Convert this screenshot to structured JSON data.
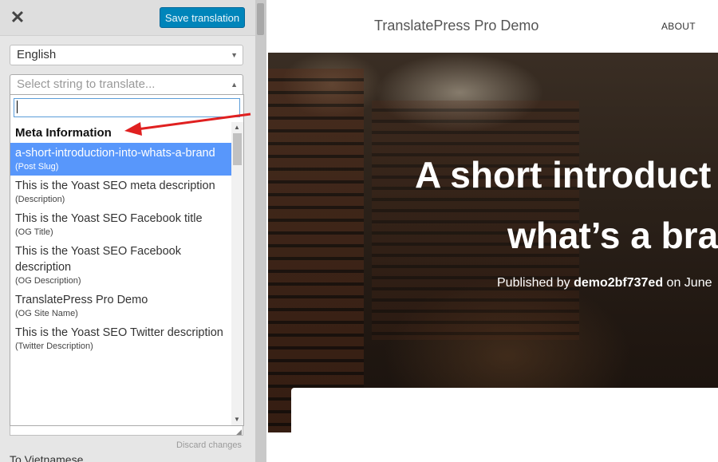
{
  "toolbar": {
    "close_icon": "close-icon",
    "save_label": "Save translation",
    "accent_color": "#0085ba"
  },
  "language_select": {
    "value": "English"
  },
  "string_select": {
    "placeholder": "Select string to translate..."
  },
  "dropdown": {
    "search_value": "",
    "group_label": "Meta Information",
    "options": [
      {
        "text": "a-short-introduction-into-whats-a-brand",
        "type": "(Post Slug)",
        "selected": true
      },
      {
        "text": "This is the Yoast SEO meta description",
        "type": "(Description)"
      },
      {
        "text": "This is the Yoast SEO Facebook title",
        "type": "(OG Title)"
      },
      {
        "text": "This is the Yoast SEO Facebook description",
        "type": "(OG Description)"
      },
      {
        "text": "TranslatePress Pro Demo",
        "type": "(OG Site Name)"
      },
      {
        "text": "This is the Yoast SEO Twitter description",
        "type": "(Twitter Description)"
      }
    ],
    "selected_color": "#5897fb"
  },
  "editor": {
    "discard_label": "Discard changes",
    "to_language": "To Vietnamese"
  },
  "preview": {
    "site_title": "TranslatePress Pro Demo",
    "nav_about": "ABOUT",
    "hero_line1": "A short introduct",
    "hero_line2": "what’s a bra",
    "meta_prefix": "Published by ",
    "meta_author": "demo2bf737ed",
    "meta_suffix": " on June"
  },
  "annotation": {
    "arrow_color": "#e02020"
  }
}
